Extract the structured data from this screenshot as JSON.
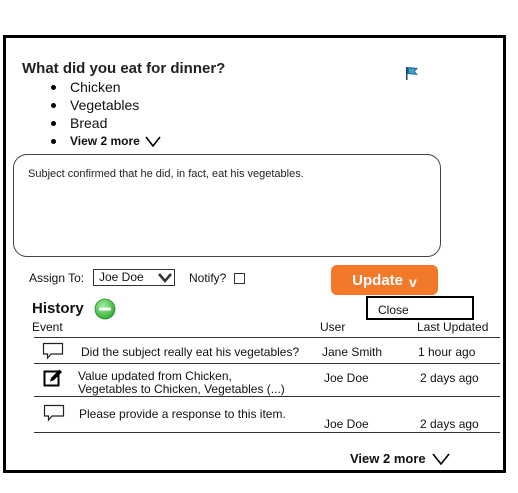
{
  "question": "What did you eat for dinner?",
  "options": [
    "Chicken",
    "Vegetables",
    "Bread"
  ],
  "view_more_options": "View 2 more",
  "note": "Subject confirmed that he did, in fact, eat his vegetables.",
  "assign": {
    "label": "Assign To:",
    "value": "Joe Doe"
  },
  "notify": {
    "label": "Notify?",
    "checked": false
  },
  "update": {
    "label": "Update",
    "arrow": "v"
  },
  "dropdown_item": "Close",
  "history": {
    "title": "History",
    "columns": {
      "event": "Event",
      "user": "User",
      "updated": "Last Updated"
    },
    "rows": [
      {
        "icon": "comment-icon",
        "text": "Did the subject really eat his vegetables?",
        "user": "Jane Smith",
        "time": "1 hour ago"
      },
      {
        "icon": "edit-icon",
        "text_line1": "Value updated from Chicken,",
        "text_line2": "Vegetables to Chicken, Vegetables (...)",
        "user": "Joe Doe",
        "time": "2 days ago"
      },
      {
        "icon": "comment-icon",
        "text": "Please provide a response to this item.",
        "user": "Joe Doe",
        "time": "2 days ago"
      }
    ],
    "view_more": "View 2 more"
  },
  "colors": {
    "accent": "#f2782a",
    "flag": "#1a6fa0",
    "history_icon": "#3cc43c"
  }
}
